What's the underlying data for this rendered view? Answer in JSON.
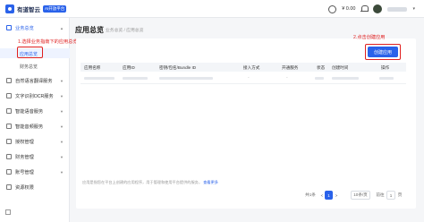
{
  "topbar": {
    "logo_text": "有道智云",
    "logo_badge": "AI开放平台",
    "balance": "¥ 0.00"
  },
  "sidebar": {
    "parent_active": {
      "label": "业务总览"
    },
    "sub_items": [
      {
        "label": "应用总览"
      },
      {
        "label": "财务总览"
      }
    ],
    "items": [
      {
        "label": "自然语言翻译服务"
      },
      {
        "label": "文字识别OCR服务"
      },
      {
        "label": "智能语音服务"
      },
      {
        "label": "智能音频服务"
      },
      {
        "label": "授权管理"
      },
      {
        "label": "财务管理"
      },
      {
        "label": "账号管理"
      },
      {
        "label": "资源权限"
      }
    ]
  },
  "annotations": {
    "step1": "1.选择业务指南下的应用总览",
    "step2": "2.点击创建应用"
  },
  "main": {
    "title": "应用总览",
    "breadcrumb": "业务总览 / 应用总览",
    "create_button": "创建应用",
    "columns": [
      "应用名称",
      "应用ID",
      "密钥/包名/Bundle ID",
      "接入方式",
      "开通服务",
      "状态",
      "创建时间",
      "操作"
    ],
    "row_dash": "-",
    "hint_text": "应用是指您在平台上创建的应用程序，用于管理和使用平台提供的服务，",
    "hint_link": "查看更多"
  },
  "pagination": {
    "total": "共1条",
    "prev": "<",
    "page": "1",
    "next": ">",
    "page_size": "10条/页",
    "goto_label": "前往",
    "goto_value": "1",
    "goto_suffix": "页"
  }
}
